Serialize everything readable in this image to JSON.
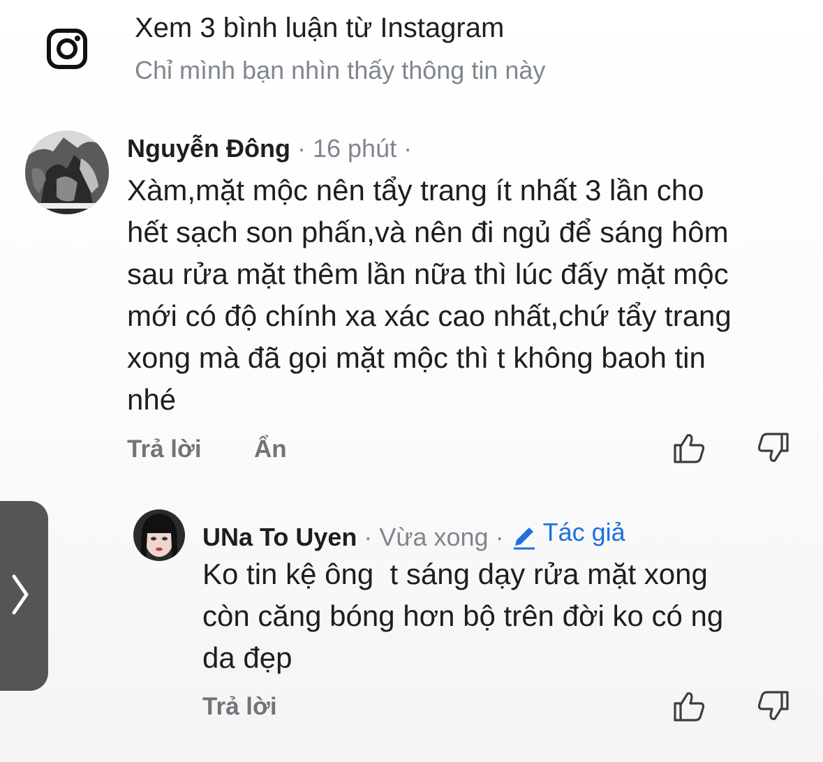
{
  "instagram_banner": {
    "icon": "instagram-icon",
    "title": "Xem 3 bình luận từ Instagram",
    "subtitle": "Chỉ mình bạn nhìn thấy thông tin này"
  },
  "comments": [
    {
      "author": "Nguyễn Đông",
      "time": "16 phút",
      "separator": "·",
      "body_lines": [
        "Xàm,mặt mộc nên tẩy trang ít nhất 3 lần cho",
        "hết sạch son phấn,và nên đi ngủ để sáng hôm",
        "sau rửa mặt thêm lần nữa thì lúc đấy mặt mộc",
        "mới có độ chính xa xác cao nhất,chứ tẩy trang",
        "xong mà đã gọi mặt mộc thì t không baoh tin",
        "nhé"
      ],
      "actions": {
        "reply": "Trả lời",
        "hide": "Ẩn"
      }
    },
    {
      "author": "UNa To Uyen",
      "time": "Vừa xong",
      "separator": "·",
      "badge": "Tác giả",
      "body_lines": [
        "Ko tin kệ ông  t sáng dạy rửa mặt xong",
        "còn căng bóng hơn bộ trên đời ko có ng",
        "da đẹp"
      ],
      "actions": {
        "reply": "Trả lời"
      }
    }
  ],
  "icons": {
    "like": "thumbs-up-icon",
    "dislike": "thumbs-down-icon",
    "expand": "chevron-right-icon",
    "author_badge": "pencil-icon"
  },
  "colors": {
    "text": "#1c1e21",
    "muted": "#80868d",
    "accent": "#1f6fe0",
    "action": "#6f747a"
  }
}
